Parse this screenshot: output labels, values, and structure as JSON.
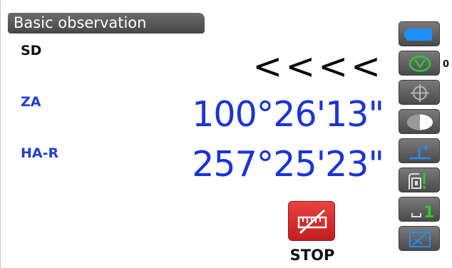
{
  "title": "Basic observation",
  "rows": [
    {
      "label": "SD",
      "value": "<<<<"
    },
    {
      "label": "ZA",
      "value": "100°26'13\""
    },
    {
      "label": "HA-R",
      "value": "257°25'23\""
    }
  ],
  "stop_button": {
    "label": "STOP",
    "icon": "measure-stop-icon"
  },
  "sidebar": {
    "items": [
      {
        "icon": "battery-icon"
      },
      {
        "icon": "prism-target-icon",
        "badge": "0"
      },
      {
        "icon": "crosshair-icon"
      },
      {
        "icon": "half-circle-icon"
      },
      {
        "icon": "height-offset-icon"
      },
      {
        "icon": "tilt-icon"
      },
      {
        "icon": "level-1-icon",
        "badge": "1"
      },
      {
        "icon": "edit-data-icon"
      }
    ]
  },
  "colors": {
    "blue_text": "#1a33d8",
    "stop_red": "#d63030",
    "accent_green": "#2ecc2e",
    "accent_blue": "#1f8fff"
  }
}
